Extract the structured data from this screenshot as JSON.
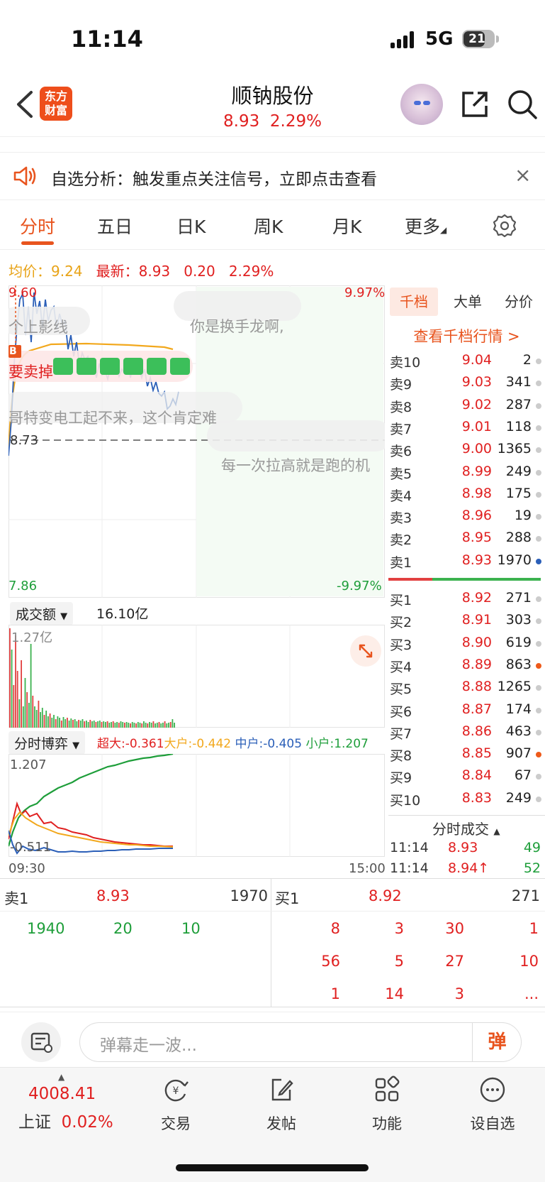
{
  "status": {
    "time": "11:14",
    "network": "5G",
    "battery": "21"
  },
  "header": {
    "logo_line1": "东方",
    "logo_line2": "财富",
    "title": "顺钠股份",
    "subtitle_price": "8.93",
    "subtitle_pct": "2.29%"
  },
  "banner": {
    "text": "自选分析：触发重点关注信号，立即点击查看",
    "close": "×"
  },
  "tabs": [
    {
      "label": "分时"
    },
    {
      "label": "五日"
    },
    {
      "label": "日K"
    },
    {
      "label": "周K"
    },
    {
      "label": "月K"
    },
    {
      "label": "更多"
    }
  ],
  "price_row": {
    "avg_label": "均价：",
    "avg": "9.24",
    "latest_label": "最新：",
    "latest": "8.93",
    "change": "0.20",
    "pct": "2.29%"
  },
  "main_chart": {
    "y_top": "9.60",
    "pct_top": "9.97%",
    "y_bottom": "7.86",
    "pct_bottom": "-9.97%",
    "prev_close": "8.73",
    "b_tag": "B",
    "danmaku": [
      "个上影线",
      "你是换手龙啊,",
      "要卖掉",
      "哥特变电工起不来，这个肯定难",
      "每一次拉高就是跑的机"
    ]
  },
  "volume": {
    "selector": "成交额",
    "total": "16.10亿",
    "y_top": "1.27亿"
  },
  "game": {
    "selector": "分时博弈",
    "super_label": "超大:",
    "super": "-0.361",
    "large_label": "大户:",
    "large": "-0.442",
    "mid_label": "中户:",
    "mid": "-0.405",
    "small_label": "小户:",
    "small": "1.207",
    "y_top": "1.207",
    "y_bottom": "-0.511",
    "time_start": "09:30",
    "time_end": "15:00"
  },
  "orderbook": {
    "tabs": [
      "千档",
      "大单",
      "分价"
    ],
    "link": "查看千档行情 >",
    "asks": [
      {
        "label": "卖10",
        "price": "9.04",
        "vol": "2"
      },
      {
        "label": "卖9",
        "price": "9.03",
        "vol": "341"
      },
      {
        "label": "卖8",
        "price": "9.02",
        "vol": "287"
      },
      {
        "label": "卖7",
        "price": "9.01",
        "vol": "118"
      },
      {
        "label": "卖6",
        "price": "9.00",
        "vol": "1365"
      },
      {
        "label": "卖5",
        "price": "8.99",
        "vol": "249"
      },
      {
        "label": "卖4",
        "price": "8.98",
        "vol": "175"
      },
      {
        "label": "卖3",
        "price": "8.96",
        "vol": "19"
      },
      {
        "label": "卖2",
        "price": "8.95",
        "vol": "288"
      },
      {
        "label": "卖1",
        "price": "8.93",
        "vol": "1970"
      }
    ],
    "bids": [
      {
        "label": "买1",
        "price": "8.92",
        "vol": "271"
      },
      {
        "label": "买2",
        "price": "8.91",
        "vol": "303"
      },
      {
        "label": "买3",
        "price": "8.90",
        "vol": "619"
      },
      {
        "label": "买4",
        "price": "8.89",
        "vol": "863"
      },
      {
        "label": "买5",
        "price": "8.88",
        "vol": "1265"
      },
      {
        "label": "买6",
        "price": "8.87",
        "vol": "174"
      },
      {
        "label": "买7",
        "price": "8.86",
        "vol": "463"
      },
      {
        "label": "买8",
        "price": "8.85",
        "vol": "907"
      },
      {
        "label": "买9",
        "price": "8.84",
        "vol": "67"
      },
      {
        "label": "买10",
        "price": "8.83",
        "vol": "249"
      }
    ],
    "ticks_title": "分时成交",
    "ticks": [
      {
        "time": "11:14",
        "price": "8.93",
        "vol": "49"
      },
      {
        "time": "11:14",
        "price": "8.94↑",
        "vol": "52"
      }
    ]
  },
  "lower": {
    "sell_label": "卖1",
    "sell_price": "8.93",
    "sell_vol": "1970",
    "buy_label": "买1",
    "buy_price": "8.92",
    "buy_vol": "271",
    "sell_orders": [
      "1940",
      "20",
      "10"
    ],
    "buy_orders": [
      [
        "8",
        "3",
        "30",
        "1"
      ],
      [
        "56",
        "5",
        "27",
        "10"
      ],
      [
        "1",
        "14",
        "3",
        "..."
      ]
    ]
  },
  "bottom": {
    "input_placeholder": "弹幕走一波...",
    "danmu_button": "弹"
  },
  "nav": {
    "index_value": "4008.41",
    "index_name": "上证",
    "index_pct": "0.02%",
    "items": [
      "交易",
      "发帖",
      "功能",
      "设自选"
    ]
  }
}
